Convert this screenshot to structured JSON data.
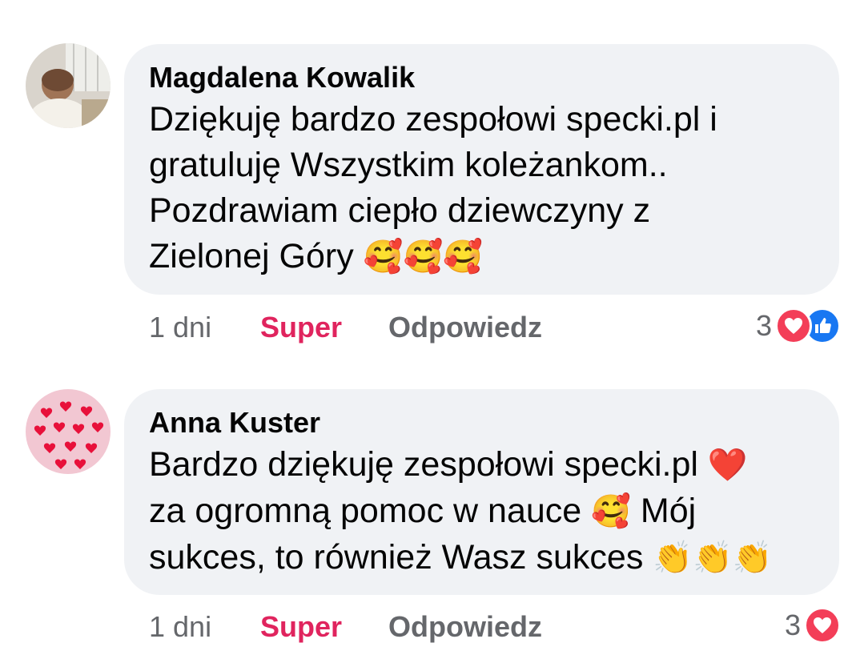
{
  "comments": [
    {
      "author": "Magdalena Kowalik",
      "text": "Dziękuję bardzo zespołowi specki.pl i\ngratuluję Wszystkim koleżankom..\nPozdrawiam ciepło dziewczyny z\nZielonej Góry",
      "emoji_suffix": "🥰🥰🥰",
      "time": "1 dni",
      "reaction_label": "Super",
      "reply_label": "Odpowiedz",
      "reaction_count": "3",
      "reaction_icons": [
        "heart-icon",
        "like-icon"
      ]
    },
    {
      "author": "Anna Kuster",
      "text_line1": "Bardzo dziękuję zespołowi specki.pl",
      "emoji_line1": "❤️",
      "text_line2": "za ogromną pomoc w nauce",
      "emoji_line2": "🥰",
      "text_line2b": "Mój",
      "text_line3": "sukces, to również Wasz sukces",
      "emoji_line3": "👏👏👏",
      "time": "1 dni",
      "reaction_label": "Super",
      "reply_label": "Odpowiedz",
      "reaction_count": "3",
      "reaction_icons": [
        "heart-icon"
      ]
    }
  ],
  "colors": {
    "bubble": "#f0f2f5",
    "super": "#e0245e",
    "secondary_text": "#65676b",
    "heart": "#f33e58",
    "like": "#1877f2"
  }
}
